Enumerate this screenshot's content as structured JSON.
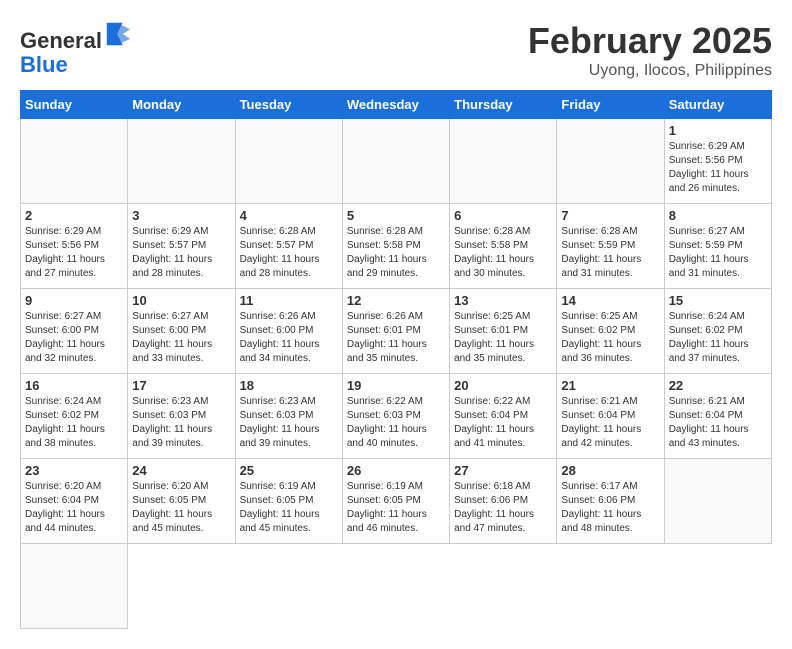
{
  "header": {
    "logo_general": "General",
    "logo_blue": "Blue",
    "main_title": "February 2025",
    "subtitle": "Uyong, Ilocos, Philippines"
  },
  "weekdays": [
    "Sunday",
    "Monday",
    "Tuesday",
    "Wednesday",
    "Thursday",
    "Friday",
    "Saturday"
  ],
  "days": [
    {
      "num": "",
      "info": ""
    },
    {
      "num": "",
      "info": ""
    },
    {
      "num": "",
      "info": ""
    },
    {
      "num": "",
      "info": ""
    },
    {
      "num": "",
      "info": ""
    },
    {
      "num": "",
      "info": ""
    },
    {
      "num": "1",
      "info": "Sunrise: 6:29 AM\nSunset: 5:56 PM\nDaylight: 11 hours\nand 26 minutes."
    },
    {
      "num": "2",
      "info": "Sunrise: 6:29 AM\nSunset: 5:56 PM\nDaylight: 11 hours\nand 27 minutes."
    },
    {
      "num": "3",
      "info": "Sunrise: 6:29 AM\nSunset: 5:57 PM\nDaylight: 11 hours\nand 28 minutes."
    },
    {
      "num": "4",
      "info": "Sunrise: 6:28 AM\nSunset: 5:57 PM\nDaylight: 11 hours\nand 28 minutes."
    },
    {
      "num": "5",
      "info": "Sunrise: 6:28 AM\nSunset: 5:58 PM\nDaylight: 11 hours\nand 29 minutes."
    },
    {
      "num": "6",
      "info": "Sunrise: 6:28 AM\nSunset: 5:58 PM\nDaylight: 11 hours\nand 30 minutes."
    },
    {
      "num": "7",
      "info": "Sunrise: 6:28 AM\nSunset: 5:59 PM\nDaylight: 11 hours\nand 31 minutes."
    },
    {
      "num": "8",
      "info": "Sunrise: 6:27 AM\nSunset: 5:59 PM\nDaylight: 11 hours\nand 31 minutes."
    },
    {
      "num": "9",
      "info": "Sunrise: 6:27 AM\nSunset: 6:00 PM\nDaylight: 11 hours\nand 32 minutes."
    },
    {
      "num": "10",
      "info": "Sunrise: 6:27 AM\nSunset: 6:00 PM\nDaylight: 11 hours\nand 33 minutes."
    },
    {
      "num": "11",
      "info": "Sunrise: 6:26 AM\nSunset: 6:00 PM\nDaylight: 11 hours\nand 34 minutes."
    },
    {
      "num": "12",
      "info": "Sunrise: 6:26 AM\nSunset: 6:01 PM\nDaylight: 11 hours\nand 35 minutes."
    },
    {
      "num": "13",
      "info": "Sunrise: 6:25 AM\nSunset: 6:01 PM\nDaylight: 11 hours\nand 35 minutes."
    },
    {
      "num": "14",
      "info": "Sunrise: 6:25 AM\nSunset: 6:02 PM\nDaylight: 11 hours\nand 36 minutes."
    },
    {
      "num": "15",
      "info": "Sunrise: 6:24 AM\nSunset: 6:02 PM\nDaylight: 11 hours\nand 37 minutes."
    },
    {
      "num": "16",
      "info": "Sunrise: 6:24 AM\nSunset: 6:02 PM\nDaylight: 11 hours\nand 38 minutes."
    },
    {
      "num": "17",
      "info": "Sunrise: 6:23 AM\nSunset: 6:03 PM\nDaylight: 11 hours\nand 39 minutes."
    },
    {
      "num": "18",
      "info": "Sunrise: 6:23 AM\nSunset: 6:03 PM\nDaylight: 11 hours\nand 39 minutes."
    },
    {
      "num": "19",
      "info": "Sunrise: 6:22 AM\nSunset: 6:03 PM\nDaylight: 11 hours\nand 40 minutes."
    },
    {
      "num": "20",
      "info": "Sunrise: 6:22 AM\nSunset: 6:04 PM\nDaylight: 11 hours\nand 41 minutes."
    },
    {
      "num": "21",
      "info": "Sunrise: 6:21 AM\nSunset: 6:04 PM\nDaylight: 11 hours\nand 42 minutes."
    },
    {
      "num": "22",
      "info": "Sunrise: 6:21 AM\nSunset: 6:04 PM\nDaylight: 11 hours\nand 43 minutes."
    },
    {
      "num": "23",
      "info": "Sunrise: 6:20 AM\nSunset: 6:04 PM\nDaylight: 11 hours\nand 44 minutes."
    },
    {
      "num": "24",
      "info": "Sunrise: 6:20 AM\nSunset: 6:05 PM\nDaylight: 11 hours\nand 45 minutes."
    },
    {
      "num": "25",
      "info": "Sunrise: 6:19 AM\nSunset: 6:05 PM\nDaylight: 11 hours\nand 45 minutes."
    },
    {
      "num": "26",
      "info": "Sunrise: 6:19 AM\nSunset: 6:05 PM\nDaylight: 11 hours\nand 46 minutes."
    },
    {
      "num": "27",
      "info": "Sunrise: 6:18 AM\nSunset: 6:06 PM\nDaylight: 11 hours\nand 47 minutes."
    },
    {
      "num": "28",
      "info": "Sunrise: 6:17 AM\nSunset: 6:06 PM\nDaylight: 11 hours\nand 48 minutes."
    },
    {
      "num": "",
      "info": ""
    },
    {
      "num": "",
      "info": ""
    }
  ]
}
